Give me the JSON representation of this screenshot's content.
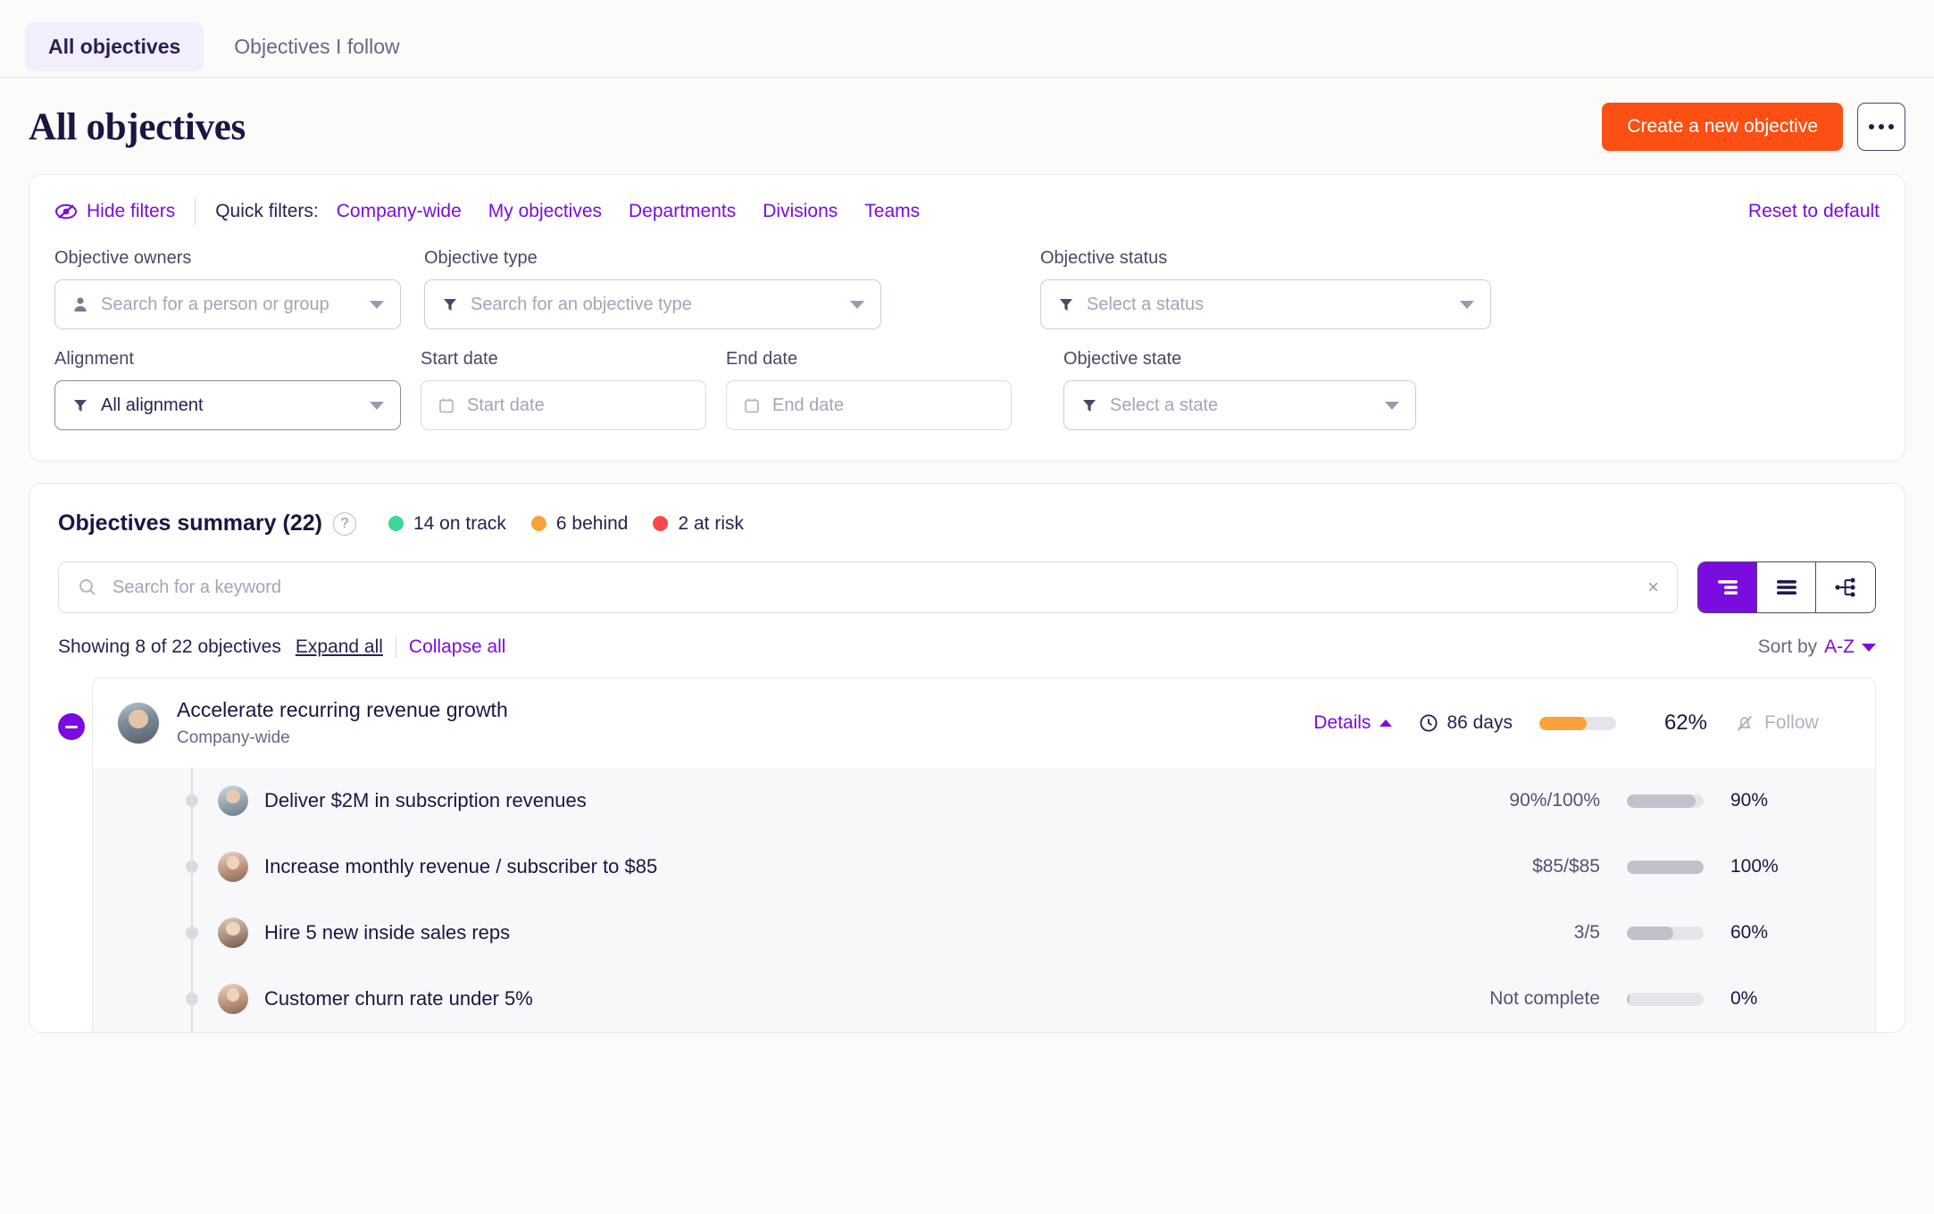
{
  "tabs": [
    {
      "label": "All objectives",
      "active": true
    },
    {
      "label": "Objectives I follow",
      "active": false
    }
  ],
  "header": {
    "title": "All objectives",
    "create_button": "Create a new objective",
    "more_button": "…"
  },
  "filters": {
    "hide_filters": "Hide filters",
    "quick_filters_label": "Quick filters:",
    "quick_links": [
      "Company-wide",
      "My objectives",
      "Departments",
      "Divisions",
      "Teams"
    ],
    "reset": "Reset to default",
    "fields": {
      "owners": {
        "label": "Objective owners",
        "placeholder": "Search for a person or group",
        "value": ""
      },
      "type": {
        "label": "Objective type",
        "placeholder": "Search for an objective type",
        "value": ""
      },
      "status": {
        "label": "Objective status",
        "placeholder": "Select a status",
        "value": ""
      },
      "alignment": {
        "label": "Alignment",
        "placeholder": "",
        "value": "All alignment"
      },
      "start_date": {
        "label": "Start date",
        "placeholder": "Start date",
        "value": ""
      },
      "end_date": {
        "label": "End date",
        "placeholder": "End date",
        "value": ""
      },
      "state": {
        "label": "Objective state",
        "placeholder": "Select a state",
        "value": ""
      }
    }
  },
  "summary": {
    "title": "Objectives summary (22)",
    "help": "?",
    "stats": [
      {
        "label": "14 on track",
        "color": "#3ed598"
      },
      {
        "label": "6 behind",
        "color": "#f9a23b"
      },
      {
        "label": "2 at risk",
        "color": "#f9484a"
      }
    ],
    "search_placeholder": "Search for a keyword",
    "search_value": "",
    "clear": "×",
    "showing": "Showing 8 of 22 objectives",
    "expand_all": "Expand all",
    "collapse_all": "Collapse all",
    "sort_label": "Sort by",
    "sort_value": "A-Z",
    "views": [
      {
        "name": "nested-list-view",
        "active": true
      },
      {
        "name": "flat-list-view",
        "active": false
      },
      {
        "name": "tree-chart-view",
        "active": false
      }
    ]
  },
  "objective": {
    "name": "Accelerate recurring revenue growth",
    "scope": "Company-wide",
    "details_label": "Details",
    "days": "86 days",
    "progress_pct": "62%",
    "progress_value": 62,
    "progress_color": "#f9a23b",
    "follow_label": "Follow",
    "key_results": [
      {
        "name": "Deliver $2M in subscription revenues",
        "value": "90%/100%",
        "pct": "90%",
        "progress": 90
      },
      {
        "name": "Increase monthly revenue / subscriber to $85",
        "value": "$85/$85",
        "pct": "100%",
        "progress": 100
      },
      {
        "name": "Hire 5 new inside sales reps",
        "value": "3/5",
        "pct": "60%",
        "progress": 60
      },
      {
        "name": "Customer churn rate under 5%",
        "value": "Not complete",
        "pct": "0%",
        "progress": 0
      }
    ]
  },
  "colors": {
    "accent_purple": "#7b0ce0",
    "accent_orange": "#fb4f14",
    "ink": "#1e1442"
  }
}
